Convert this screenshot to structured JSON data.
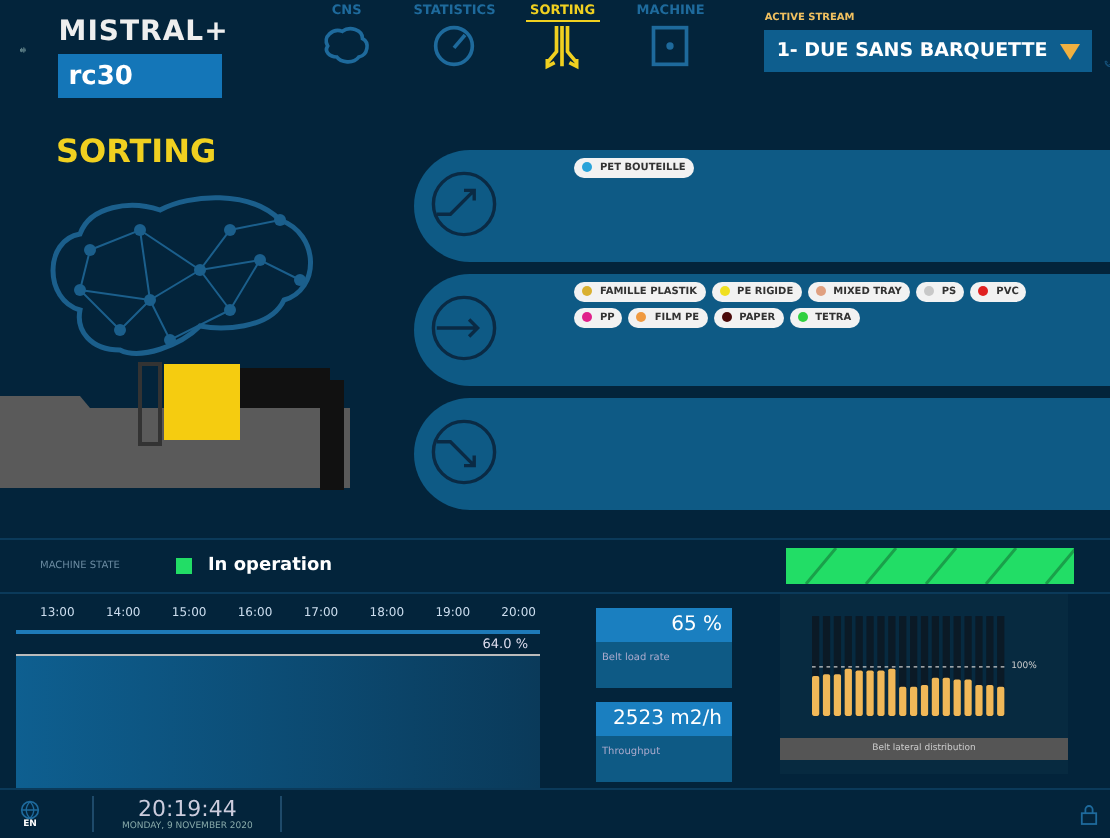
{
  "header": {
    "logo": "MISTRAL+",
    "machine_id": "rc30",
    "tabs": [
      {
        "label": "CNS",
        "kind": "brain",
        "selected": false
      },
      {
        "label": "STATISTICS",
        "kind": "gauge",
        "selected": false
      },
      {
        "label": "SORTING",
        "kind": "sort",
        "selected": true
      },
      {
        "label": "MACHINE",
        "kind": "machine",
        "selected": false
      }
    ],
    "active_stream": {
      "label": "ACTIVE STREAM",
      "value": "1- DUE SANS BARQUETTE"
    }
  },
  "page_title": "SORTING",
  "lanes": [
    {
      "kind": "up",
      "chips": [
        {
          "label": "PET BOUTEILLE",
          "color": "#29a3d9"
        }
      ]
    },
    {
      "kind": "straight",
      "chips": [
        {
          "label": "FAMILLE PLASTIK",
          "color": "#d9b030"
        },
        {
          "label": "PE RIGIDE",
          "color": "#f0e020"
        },
        {
          "label": "MIXED TRAY",
          "color": "#e0a080"
        },
        {
          "label": "PS",
          "color": "#c8c8c8"
        },
        {
          "label": "PVC",
          "color": "#e02020"
        },
        {
          "label": "PP",
          "color": "#e0208a"
        },
        {
          "label": "FILM PE",
          "color": "#f09a40"
        },
        {
          "label": "PAPER",
          "color": "#4a0a0a"
        },
        {
          "label": "TETRA",
          "color": "#30d040"
        }
      ]
    },
    {
      "kind": "down"
    }
  ],
  "machine_state": {
    "label": "MACHINE STATE",
    "value": "In operation",
    "color": "#22dd66"
  },
  "timeline": {
    "hours": [
      "13:00",
      "14:00",
      "15:00",
      "16:00",
      "17:00",
      "18:00",
      "19:00",
      "20:00"
    ],
    "reading": "64.0 %"
  },
  "readouts": [
    {
      "value": "65 %",
      "label": "Belt load rate"
    },
    {
      "value": "2523 m2/h",
      "label": "Throughput"
    }
  ],
  "belt": {
    "scale_label": "100%",
    "caption": "Belt lateral distribution"
  },
  "footer": {
    "language": "EN",
    "time": "20:19:44",
    "date": "MONDAY, 9 NOVEMBER 2020"
  }
}
